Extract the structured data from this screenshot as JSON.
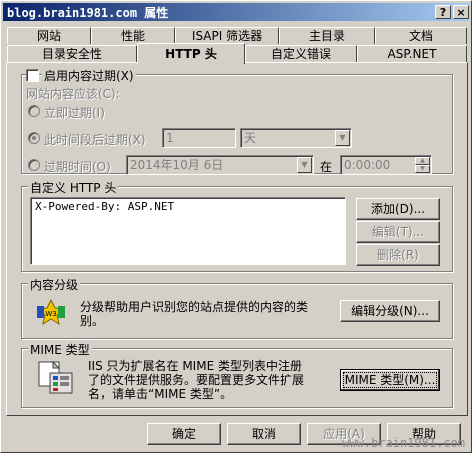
{
  "window": {
    "title": "blog.brain1981.com 属性",
    "help_btn": "?",
    "close_btn": "×"
  },
  "tabs_row1": [
    {
      "label": "网站"
    },
    {
      "label": "性能"
    },
    {
      "label": "ISAPI 筛选器"
    },
    {
      "label": "主目录"
    },
    {
      "label": "文档"
    }
  ],
  "tabs_row2": [
    {
      "label": "目录安全性"
    },
    {
      "label": "HTTP 头"
    },
    {
      "label": "自定义错误"
    },
    {
      "label": "ASP.NET"
    }
  ],
  "expiry": {
    "checkbox_label": "启用内容过期(X)",
    "heading": "网站内容应该(C):",
    "radio_now": "立即过期(I)",
    "radio_after": "此时间段后过期(X)",
    "after_value": "1",
    "after_unit": "天",
    "radio_on": "过期时间(O)",
    "date_value": "2014年10月 6日",
    "at_label": "在",
    "time_value": "0:00:00"
  },
  "custom_headers": {
    "group_label": "自定义 HTTP 头",
    "items": [
      "X-Powered-By: ASP.NET"
    ],
    "add_button": "添加(D)...",
    "edit_button": "编辑(T)...",
    "remove_button": "删除(R)"
  },
  "ratings": {
    "group_label": "内容分级",
    "description": "分级帮助用户识别您的站点提供的内容的类别。",
    "description_line1": "分级帮助用户识别您的站点提供的内容的类",
    "description_line2": "别。",
    "edit_button": "编辑分级(N)..."
  },
  "mime": {
    "group_label": "MIME 类型",
    "line1": "IIS 只为扩展名在 MIME 类型列表中注册",
    "line2": "了的文件提供服务。要配置更多文件扩展",
    "line3": "名，请单击“MIME 类型”。",
    "button": "MIME 类型(M)..."
  },
  "footer": {
    "ok": "确定",
    "cancel": "取消",
    "apply": "应用(A)",
    "help": "帮助",
    "watermark": "www.brain1981.com"
  }
}
